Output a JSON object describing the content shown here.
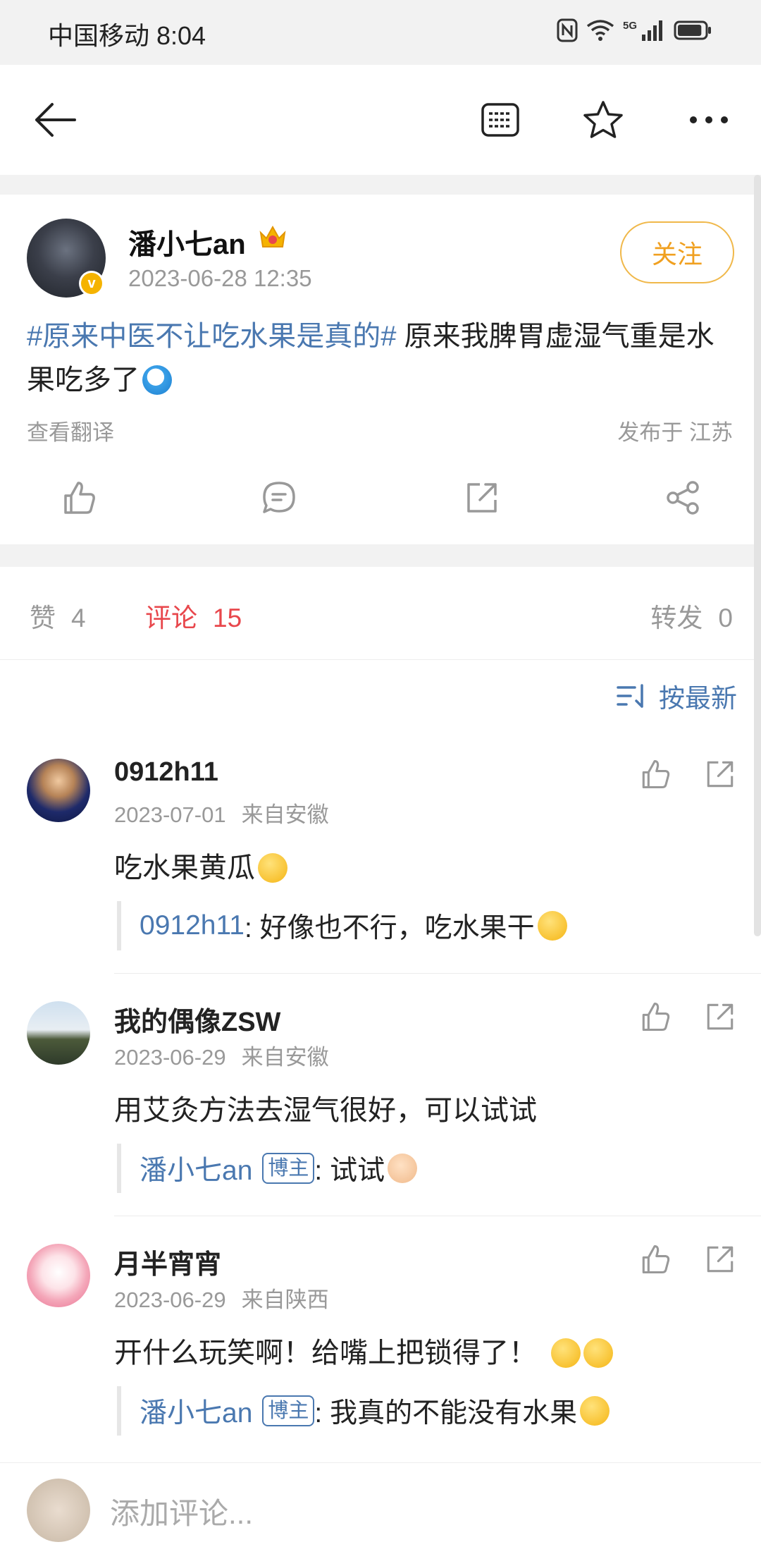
{
  "status_bar": {
    "carrier_time": "中国移动 8:04",
    "network": "5G",
    "battery_level": 0.9
  },
  "toolbar": {
    "back_icon": "arrow-left-icon",
    "icons": [
      "document-list-icon",
      "star-icon",
      "more-icon"
    ]
  },
  "post": {
    "author": "潘小七an",
    "time": "2023-06-28 12:35",
    "follow_label": "关注",
    "topic": "#原来中医不让吃水果是真的#",
    "text": " 原来我脾胃虚湿气重是水果吃多了",
    "translate": "查看翻译",
    "location": "发布于 江苏"
  },
  "tabs": {
    "likes_label": "赞",
    "likes_count": "4",
    "comments_label": "评论",
    "comments_count": "15",
    "reposts_label": "转发",
    "reposts_count": "0"
  },
  "sort_label": "按最新",
  "comments": [
    {
      "name": "0912h11",
      "date": "2023-07-01",
      "from": "来自安徽",
      "text": "吃水果黄瓜",
      "reply_name": "0912h11",
      "reply_tag": "",
      "reply_text": " : 好像也不行，吃水果干"
    },
    {
      "name": "我的偶像ZSW",
      "date": "2023-06-29",
      "from": "来自安徽",
      "text": "用艾灸方法去湿气很好，可以试试",
      "reply_name": "潘小七an",
      "reply_tag": "博主",
      "reply_text": " : 试试"
    },
    {
      "name": "月半宵宵",
      "date": "2023-06-29",
      "from": "来自陕西",
      "text": "开什么玩笑啊！给嘴上把锁得了！",
      "reply_name": "潘小七an",
      "reply_tag": "博主",
      "reply_text": " : 我真的不能没有水果"
    }
  ],
  "bottom_bar": {
    "placeholder": "添加评论..."
  },
  "colors": {
    "accent_blue": "#4a78b0",
    "accent_red": "#e8474c",
    "follow_orange": "#f0a020"
  }
}
